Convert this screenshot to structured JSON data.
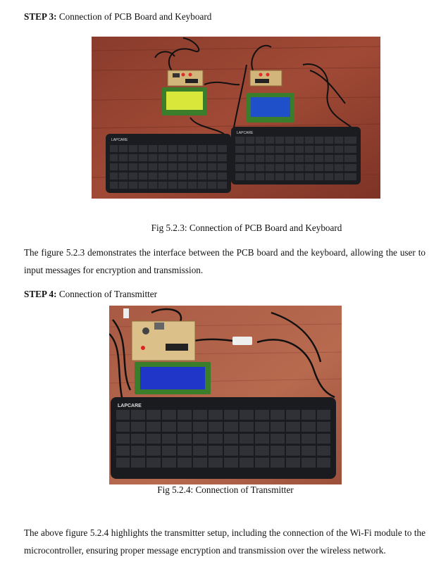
{
  "step3": {
    "label": "STEP 3:",
    "text": " Connection of PCB Board and Keyboard"
  },
  "fig1": {
    "caption": "Fig 5.2.3: Connection of PCB Board and Keyboard",
    "keyboard_brand": "LAPCARE"
  },
  "para1": "The figure 5.2.3 demonstrates the interface between the PCB board and the keyboard, allowing  the user to input messages for encryption and transmission.",
  "step4": {
    "label": "STEP 4:",
    "text": " Connection of Transmitter"
  },
  "fig2": {
    "caption": "Fig 5.2.4: Connection of Transmitter",
    "keyboard_brand": "LAPCARE"
  },
  "para2": "The above figure 5.2.4 highlights the transmitter setup, including the connection of the Wi-Fi module to the microcontroller, ensuring proper message encryption and transmission over the wireless network."
}
